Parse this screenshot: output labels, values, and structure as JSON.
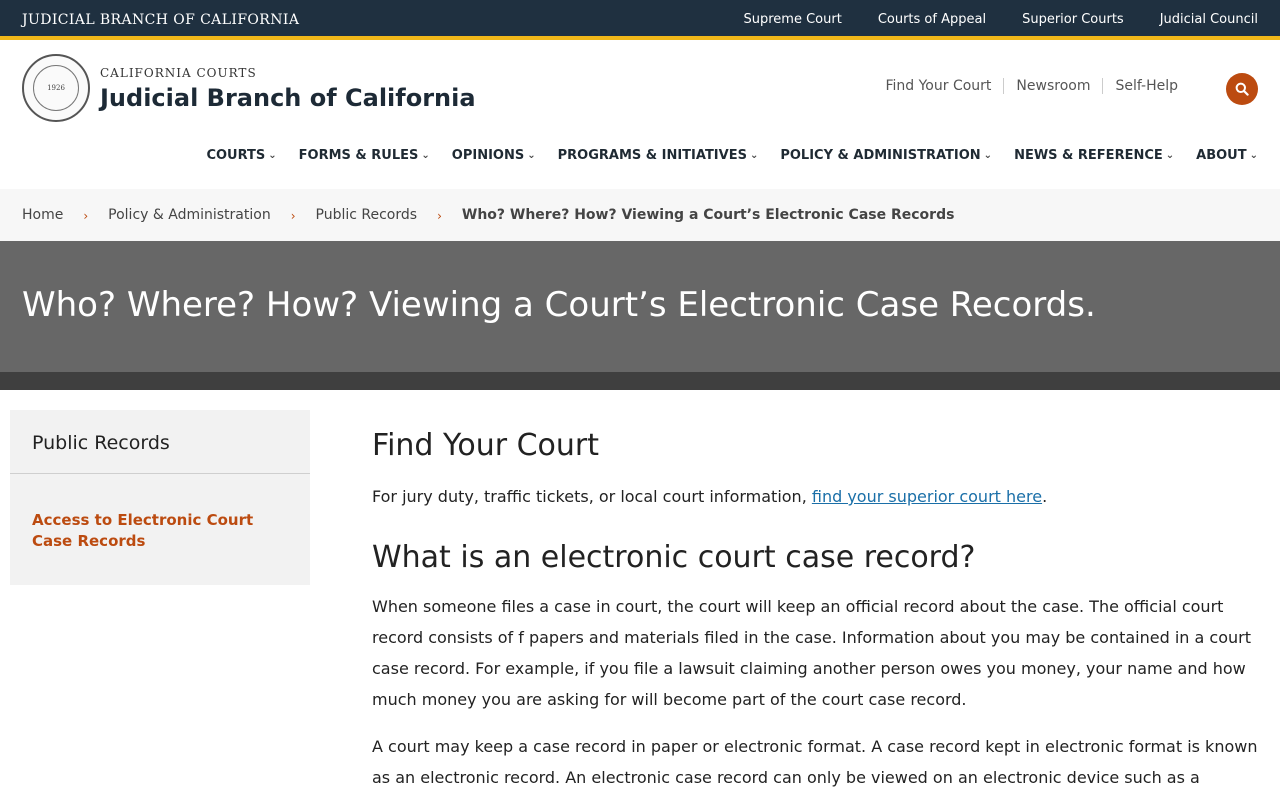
{
  "topbar": {
    "brand": "JUDICIAL BRANCH OF CALIFORNIA",
    "links": [
      "Supreme Court",
      "Courts of Appeal",
      "Superior Courts",
      "Judicial Council"
    ]
  },
  "header": {
    "seal_text": "1926",
    "eyebrow": "CALIFORNIA COURTS",
    "title": "Judicial Branch of California",
    "util_links": [
      "Find Your Court",
      "Newsroom",
      "Self-Help"
    ]
  },
  "nav": {
    "items": [
      "COURTS",
      "FORMS & RULES",
      "OPINIONS",
      "PROGRAMS & INITIATIVES",
      "POLICY & ADMINISTRATION",
      "NEWS & REFERENCE",
      "ABOUT"
    ]
  },
  "breadcrumb": {
    "items": [
      "Home",
      "Policy & Administration",
      "Public Records"
    ],
    "current": "Who? Where? How? Viewing a Court’s Electronic Case Records"
  },
  "hero": {
    "title": "Who? Where? How? Viewing a Court’s Electronic Case Records."
  },
  "sidebar": {
    "title": "Public Records",
    "link": "Access to Electronic Court Case Records"
  },
  "content": {
    "h1": "Find Your Court",
    "p1_before": "For jury duty, traffic tickets, or local court information, ",
    "p1_link": "find your superior court here",
    "p1_after": ".",
    "h2": "What is an electronic court case record?",
    "p2": "When someone files a case in court, the court will keep an official record about the case. The official court record consists of f papers and materials filed in the case. Information about you may be contained in a court case record. For example, if you file a lawsuit claiming another person owes you money, your name and how much money you are asking for will become part of the court case record.",
    "p3": "A court may keep a case record in paper or electronic format. A case record kept in electronic format is known as an electronic record. An electronic case record can only be viewed on an electronic device such as a computer,"
  },
  "colors": {
    "topbar_bg": "#1f3040",
    "accent_gold": "#f0b719",
    "accent_orange": "#bc4b10",
    "hero_bg": "#676767",
    "link_blue": "#1a6fa8"
  }
}
